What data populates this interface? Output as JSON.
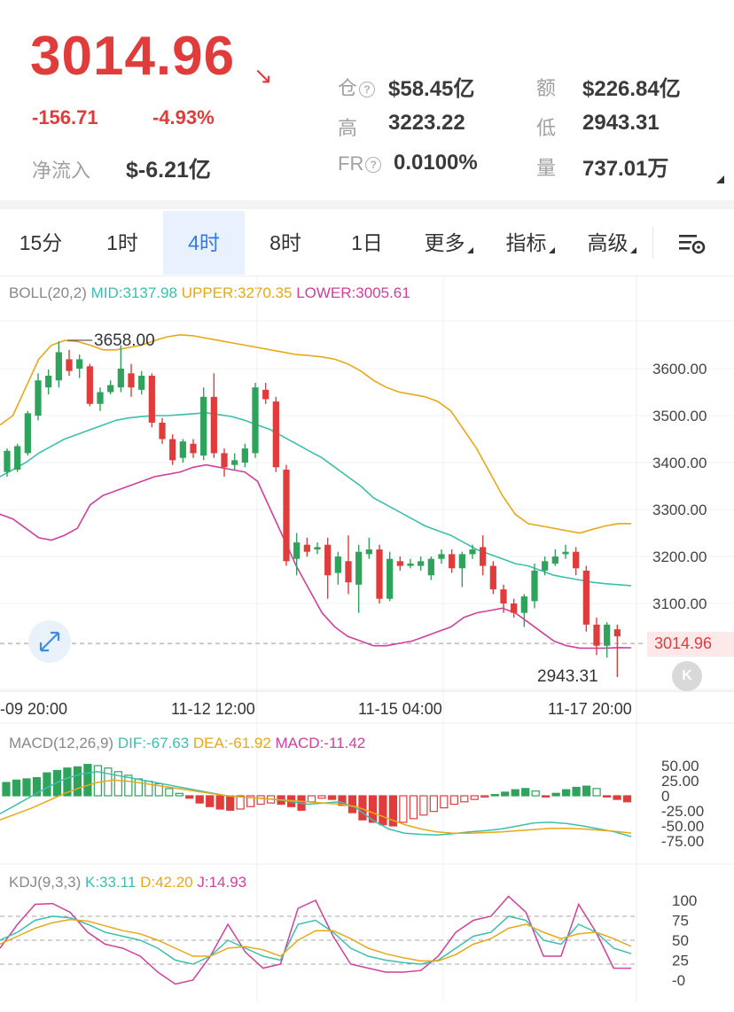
{
  "header": {
    "price": "3014.96",
    "change": "-156.71",
    "change_pct": "-4.93%",
    "net_inflow_label": "净流入",
    "net_inflow_value": "$-6.21亿",
    "open_interest_label": "仓",
    "open_interest_value": "$58.45亿",
    "turnover_label": "额",
    "turnover_value": "$226.84亿",
    "high_label": "高",
    "high_value": "3223.22",
    "low_label": "低",
    "low_value": "2943.31",
    "fr_label": "FR",
    "fr_value": "0.0100%",
    "volume_label": "量",
    "volume_value": "737.01万",
    "help_icon": "?",
    "arrow_icon": "arrow-down-right-icon",
    "colors": {
      "up": "#e03c3c",
      "down": "#2ea35b"
    }
  },
  "tabs": [
    {
      "label": "15分",
      "active": false
    },
    {
      "label": "1时",
      "active": false
    },
    {
      "label": "4时",
      "active": true
    },
    {
      "label": "8时",
      "active": false
    },
    {
      "label": "1日",
      "active": false
    },
    {
      "label": "更多",
      "active": false,
      "dropdown": true
    },
    {
      "label": "指标",
      "active": false,
      "dropdown": true
    },
    {
      "label": "高级",
      "active": false,
      "dropdown": true
    }
  ],
  "settings_icon": "chart-settings-icon",
  "boll": {
    "name": "BOLL(20,2)",
    "mid": "MID:3137.98",
    "upper": "UPPER:3270.35",
    "lower": "LOWER:3005.61",
    "colors": {
      "mid": "#3cbfae",
      "upper": "#e8a817",
      "lower": "#d0409c"
    }
  },
  "main_chart": {
    "y_ticks": [
      "3600.00",
      "3500.00",
      "3400.00",
      "3300.00",
      "3200.00",
      "3100.00"
    ],
    "current_price_tag": "3014.96",
    "high_marker": "3658.00",
    "low_marker": "2943.31",
    "x_ticks": [
      "-09 20:00",
      "11-12 12:00",
      "11-15 04:00",
      "11-17 20:00"
    ],
    "expand_icon": "expand-icon",
    "k_badge": "K"
  },
  "macd": {
    "name": "MACD(12,26,9)",
    "dif": "DIF:-67.63",
    "dea": "DEA:-61.92",
    "macd": "MACD:-11.42",
    "y_ticks": [
      "50.00",
      "25.00",
      "0",
      "-25.00",
      "-50.00",
      "-75.00"
    ],
    "colors": {
      "dif": "#3cbfae",
      "dea": "#e8a817",
      "macd": "#d0409c"
    }
  },
  "kdj": {
    "name": "KDJ(9,3,3)",
    "k": "K:33.11",
    "d": "D:42.20",
    "j": "J:14.93",
    "y_ticks": [
      "100",
      "75",
      "50",
      "25",
      "-0"
    ],
    "colors": {
      "k": "#3cbfae",
      "d": "#e8a817",
      "j": "#d0409c"
    }
  },
  "chart_data": [
    {
      "type": "candlestick",
      "title": "BOLL(20,2)",
      "timeframe": "4时",
      "ylim": [
        2900,
        3680
      ],
      "x_tick_labels": [
        "-09 20:00",
        "11-12 12:00",
        "11-15 04:00",
        "11-17 20:00"
      ],
      "candles": [
        {
          "o": 3380,
          "c": 3425,
          "h": 3430,
          "l": 3370
        },
        {
          "o": 3385,
          "c": 3435,
          "h": 3440,
          "l": 3380
        },
        {
          "o": 3420,
          "c": 3505,
          "h": 3510,
          "l": 3415
        },
        {
          "o": 3500,
          "c": 3575,
          "h": 3590,
          "l": 3490
        },
        {
          "o": 3560,
          "c": 3585,
          "h": 3598,
          "l": 3545
        },
        {
          "o": 3575,
          "c": 3635,
          "h": 3658,
          "l": 3560
        },
        {
          "o": 3620,
          "c": 3595,
          "h": 3640,
          "l": 3585
        },
        {
          "o": 3600,
          "c": 3620,
          "h": 3630,
          "l": 3580
        },
        {
          "o": 3605,
          "c": 3525,
          "h": 3610,
          "l": 3520
        },
        {
          "o": 3525,
          "c": 3550,
          "h": 3560,
          "l": 3510
        },
        {
          "o": 3550,
          "c": 3565,
          "h": 3575,
          "l": 3545
        },
        {
          "o": 3560,
          "c": 3600,
          "h": 3650,
          "l": 3550
        },
        {
          "o": 3590,
          "c": 3560,
          "h": 3610,
          "l": 3540
        },
        {
          "o": 3555,
          "c": 3585,
          "h": 3595,
          "l": 3545
        },
        {
          "o": 3585,
          "c": 3485,
          "h": 3590,
          "l": 3475
        },
        {
          "o": 3485,
          "c": 3450,
          "h": 3495,
          "l": 3440
        },
        {
          "o": 3450,
          "c": 3405,
          "h": 3460,
          "l": 3395
        },
        {
          "o": 3410,
          "c": 3445,
          "h": 3450,
          "l": 3400
        },
        {
          "o": 3440,
          "c": 3420,
          "h": 3450,
          "l": 3410
        },
        {
          "o": 3415,
          "c": 3540,
          "h": 3560,
          "l": 3405
        },
        {
          "o": 3540,
          "c": 3420,
          "h": 3590,
          "l": 3410
        },
        {
          "o": 3420,
          "c": 3390,
          "h": 3430,
          "l": 3370
        },
        {
          "o": 3395,
          "c": 3405,
          "h": 3420,
          "l": 3385
        },
        {
          "o": 3400,
          "c": 3430,
          "h": 3440,
          "l": 3390
        },
        {
          "o": 3420,
          "c": 3560,
          "h": 3570,
          "l": 3410
        },
        {
          "o": 3555,
          "c": 3535,
          "h": 3570,
          "l": 3525
        },
        {
          "o": 3530,
          "c": 3390,
          "h": 3540,
          "l": 3380
        },
        {
          "o": 3385,
          "c": 3190,
          "h": 3395,
          "l": 3180
        },
        {
          "o": 3195,
          "c": 3230,
          "h": 3250,
          "l": 3160
        },
        {
          "o": 3225,
          "c": 3210,
          "h": 3240,
          "l": 3200
        },
        {
          "o": 3215,
          "c": 3220,
          "h": 3230,
          "l": 3205
        },
        {
          "o": 3225,
          "c": 3160,
          "h": 3240,
          "l": 3110
        },
        {
          "o": 3165,
          "c": 3200,
          "h": 3210,
          "l": 3140
        },
        {
          "o": 3190,
          "c": 3145,
          "h": 3245,
          "l": 3120
        },
        {
          "o": 3140,
          "c": 3210,
          "h": 3225,
          "l": 3080
        },
        {
          "o": 3205,
          "c": 3215,
          "h": 3240,
          "l": 3195
        },
        {
          "o": 3215,
          "c": 3110,
          "h": 3225,
          "l": 3100
        },
        {
          "o": 3110,
          "c": 3195,
          "h": 3210,
          "l": 3105
        },
        {
          "o": 3190,
          "c": 3180,
          "h": 3200,
          "l": 3170
        },
        {
          "o": 3180,
          "c": 3185,
          "h": 3195,
          "l": 3175
        },
        {
          "o": 3180,
          "c": 3190,
          "h": 3200,
          "l": 3170
        },
        {
          "o": 3160,
          "c": 3195,
          "h": 3200,
          "l": 3150
        },
        {
          "o": 3195,
          "c": 3205,
          "h": 3215,
          "l": 3185
        },
        {
          "o": 3205,
          "c": 3175,
          "h": 3215,
          "l": 3165
        },
        {
          "o": 3175,
          "c": 3205,
          "h": 3210,
          "l": 3135
        },
        {
          "o": 3205,
          "c": 3215,
          "h": 3225,
          "l": 3195
        },
        {
          "o": 3220,
          "c": 3180,
          "h": 3245,
          "l": 3160
        },
        {
          "o": 3180,
          "c": 3130,
          "h": 3190,
          "l": 3120
        },
        {
          "o": 3130,
          "c": 3100,
          "h": 3140,
          "l": 3080
        },
        {
          "o": 3100,
          "c": 3080,
          "h": 3110,
          "l": 3070
        },
        {
          "o": 3080,
          "c": 3115,
          "h": 3120,
          "l": 3050
        },
        {
          "o": 3105,
          "c": 3170,
          "h": 3185,
          "l": 3090
        },
        {
          "o": 3170,
          "c": 3190,
          "h": 3200,
          "l": 3160
        },
        {
          "o": 3185,
          "c": 3200,
          "h": 3215,
          "l": 3180
        },
        {
          "o": 3205,
          "c": 3210,
          "h": 3225,
          "l": 3195
        },
        {
          "o": 3210,
          "c": 3175,
          "h": 3220,
          "l": 3160
        },
        {
          "o": 3170,
          "c": 3055,
          "h": 3180,
          "l": 3040
        },
        {
          "o": 3055,
          "c": 3010,
          "h": 3070,
          "l": 2990
        },
        {
          "o": 3010,
          "c": 3055,
          "h": 3060,
          "l": 2985
        },
        {
          "o": 3045,
          "c": 3030,
          "h": 3055,
          "l": 2943.31
        }
      ],
      "boll_upper": [
        3480,
        3500,
        3560,
        3620,
        3650,
        3660,
        3658,
        3650,
        3640,
        3640,
        3645,
        3650,
        3660,
        3668,
        3672,
        3670,
        3665,
        3660,
        3655,
        3650,
        3645,
        3640,
        3635,
        3630,
        3628,
        3625,
        3620,
        3610,
        3595,
        3575,
        3560,
        3550,
        3545,
        3540,
        3530,
        3510,
        3470,
        3430,
        3380,
        3330,
        3290,
        3270,
        3265,
        3260,
        3255,
        3250,
        3258,
        3265,
        3270,
        3270
      ],
      "boll_mid": [
        3370,
        3385,
        3400,
        3420,
        3435,
        3450,
        3460,
        3470,
        3480,
        3490,
        3495,
        3498,
        3500,
        3500,
        3502,
        3504,
        3506,
        3502,
        3498,
        3490,
        3480,
        3470,
        3455,
        3440,
        3425,
        3410,
        3390,
        3370,
        3350,
        3325,
        3310,
        3295,
        3280,
        3265,
        3255,
        3245,
        3230,
        3215,
        3205,
        3195,
        3185,
        3180,
        3170,
        3160,
        3155,
        3150,
        3145,
        3142,
        3140,
        3138
      ],
      "boll_lower": [
        3290,
        3280,
        3260,
        3240,
        3235,
        3245,
        3260,
        3310,
        3330,
        3340,
        3350,
        3360,
        3370,
        3375,
        3380,
        3390,
        3395,
        3390,
        3385,
        3380,
        3360,
        3300,
        3240,
        3180,
        3130,
        3080,
        3050,
        3030,
        3020,
        3010,
        3010,
        3015,
        3020,
        3030,
        3040,
        3050,
        3070,
        3080,
        3085,
        3090,
        3080,
        3060,
        3040,
        3020,
        3010,
        3005,
        3005,
        3005,
        3006,
        3005.61
      ]
    },
    {
      "type": "bar",
      "title": "MACD(12,26,9)",
      "ylim": [
        -80,
        60
      ],
      "y_tick_labels": [
        "50.00",
        "25.00",
        "0",
        "-25.00",
        "-50.00",
        "-75.00"
      ],
      "histogram": [
        22,
        26,
        28,
        30,
        38,
        42,
        46,
        48,
        52,
        50,
        46,
        40,
        34,
        28,
        24,
        20,
        12,
        4,
        -4,
        -12,
        -18,
        -22,
        -24,
        -22,
        -18,
        -14,
        -12,
        -14,
        -18,
        -24,
        -10,
        -4,
        -6,
        -16,
        -28,
        -40,
        -44,
        -48,
        -50,
        -44,
        -38,
        -32,
        -26,
        -20,
        -14,
        -10,
        -6,
        -2,
        2,
        6,
        10,
        12,
        8,
        -2,
        4,
        10,
        14,
        16,
        12,
        -2,
        -6,
        -10
      ],
      "dif": [
        -30,
        -15,
        0,
        15,
        28,
        36,
        40,
        35,
        30,
        25,
        20,
        15,
        10,
        5,
        0,
        -2,
        -4,
        -6,
        -10,
        -14,
        -12,
        -10,
        -20,
        -40,
        -55,
        -62,
        -64,
        -65,
        -63,
        -60,
        -58,
        -55,
        -50,
        -45,
        -44,
        -46,
        -50,
        -55,
        -60,
        -67.63
      ],
      "dea": [
        -40,
        -30,
        -20,
        -8,
        4,
        14,
        22,
        26,
        24,
        20,
        16,
        12,
        8,
        4,
        0,
        -2,
        -4,
        -6,
        -8,
        -10,
        -12,
        -14,
        -18,
        -28,
        -38,
        -48,
        -55,
        -60,
        -62,
        -62,
        -61,
        -60,
        -58,
        -56,
        -54,
        -54,
        -55,
        -57,
        -59,
        -61.92
      ]
    },
    {
      "type": "line",
      "title": "KDJ(9,3,3)",
      "ylim": [
        -10,
        110
      ],
      "y_tick_labels": [
        "100",
        "75",
        "50",
        "25",
        "-0"
      ],
      "k": [
        50,
        60,
        75,
        80,
        78,
        70,
        60,
        55,
        50,
        40,
        25,
        20,
        30,
        50,
        40,
        30,
        25,
        70,
        75,
        60,
        40,
        30,
        25,
        22,
        20,
        25,
        40,
        55,
        60,
        80,
        75,
        50,
        45,
        70,
        60,
        40,
        33.11
      ],
      "d": [
        45,
        55,
        65,
        72,
        76,
        74,
        68,
        62,
        58,
        50,
        40,
        30,
        30,
        40,
        42,
        38,
        30,
        50,
        62,
        62,
        52,
        40,
        33,
        28,
        24,
        24,
        32,
        45,
        52,
        65,
        70,
        60,
        52,
        58,
        60,
        52,
        42.2
      ],
      "j": [
        40,
        70,
        95,
        96,
        85,
        60,
        45,
        40,
        30,
        10,
        -5,
        0,
        30,
        70,
        35,
        15,
        20,
        90,
        100,
        55,
        20,
        15,
        10,
        10,
        12,
        30,
        60,
        75,
        80,
        105,
        85,
        30,
        30,
        95,
        60,
        15,
        14.93
      ]
    }
  ]
}
